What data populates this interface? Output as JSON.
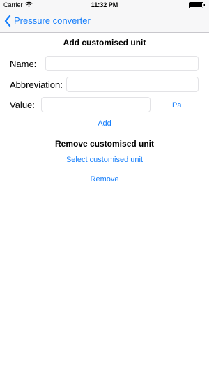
{
  "status_bar": {
    "carrier": "Carrier",
    "time": "11:32 PM"
  },
  "nav": {
    "back_label": "Pressure converter"
  },
  "add_section": {
    "title": "Add customised unit",
    "name_label": "Name:",
    "name_value": "",
    "abbreviation_label": "Abbreviation:",
    "abbreviation_value": "",
    "value_label": "Value:",
    "value_value": "",
    "unit_button": "Pa",
    "add_button": "Add"
  },
  "remove_section": {
    "title": "Remove customised unit",
    "select_button": "Select customised unit",
    "remove_button": "Remove"
  },
  "colors": {
    "accent": "#157efb",
    "bar_background": "#f7f7f8",
    "field_border": "#e3e3e6"
  }
}
